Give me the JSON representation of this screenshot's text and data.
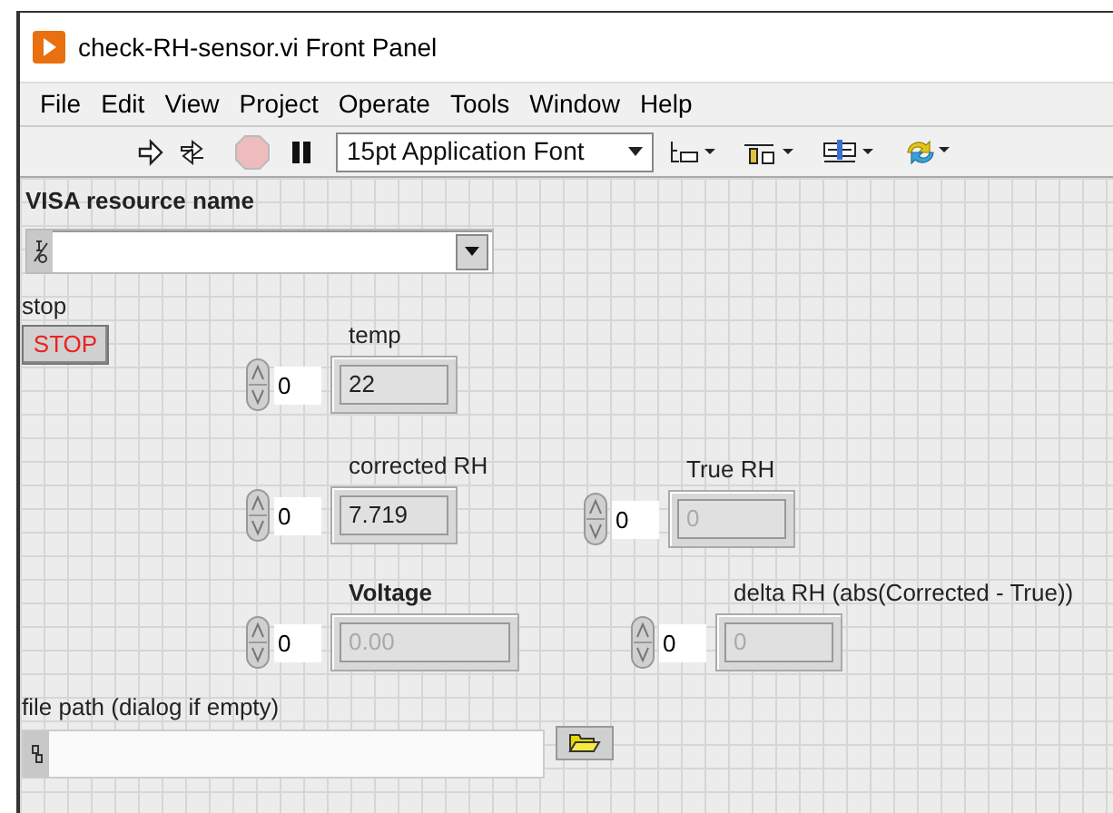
{
  "window": {
    "title": "check-RH-sensor.vi Front Panel"
  },
  "menu": [
    "File",
    "Edit",
    "View",
    "Project",
    "Operate",
    "Tools",
    "Window",
    "Help"
  ],
  "toolbar": {
    "font": "15pt Application Font"
  },
  "controls": [
    {
      "kind": "visa",
      "label": "VISA resource name",
      "bold": true
    },
    {
      "kind": "button",
      "label": "stop",
      "text": "STOP",
      "bold": false
    },
    {
      "kind": "numeric",
      "label": "temp",
      "bold": false,
      "index": "0",
      "value": "22",
      "disabled": false
    },
    {
      "kind": "numeric",
      "label": "corrected RH",
      "bold": false,
      "index": "0",
      "value": "7.719",
      "disabled": false
    },
    {
      "kind": "numeric",
      "label": "True RH",
      "bold": false,
      "index": "0",
      "value": "0",
      "disabled": true
    },
    {
      "kind": "numeric",
      "label": "Voltage",
      "bold": true,
      "index": "0",
      "value": "0.00",
      "disabled": true
    },
    {
      "kind": "numeric",
      "label": "delta RH (abs(Corrected - True))",
      "bold": false,
      "index": "0",
      "value": "0",
      "disabled": true
    },
    {
      "kind": "path",
      "label": "file path (dialog if empty)",
      "bold": false
    }
  ]
}
